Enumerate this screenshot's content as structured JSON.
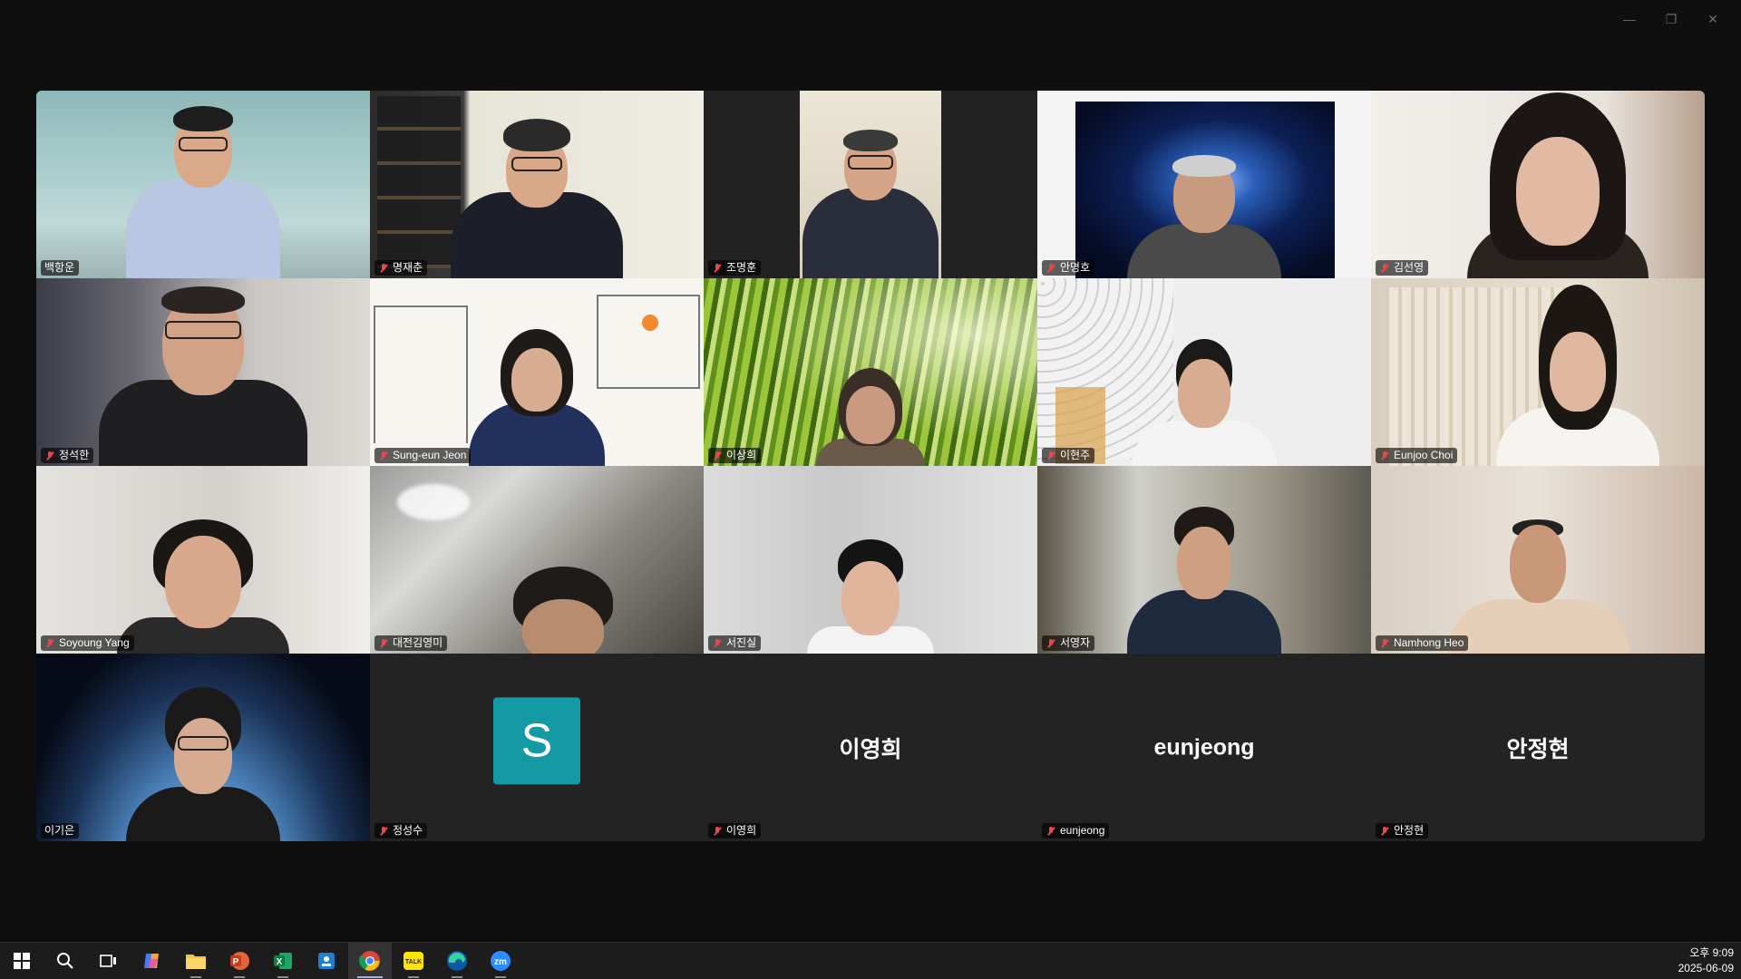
{
  "window": {
    "controls": [
      {
        "name": "minimize-button",
        "glyph": "—"
      },
      {
        "name": "restore-button",
        "glyph": "❐"
      },
      {
        "name": "close-button",
        "glyph": "✕"
      }
    ]
  },
  "participants": [
    {
      "name": "백항운",
      "muted": false,
      "video": true,
      "active_speaker": true
    },
    {
      "name": "명재춘",
      "muted": true,
      "video": true
    },
    {
      "name": "조명훈",
      "muted": true,
      "video": true
    },
    {
      "name": "안명호",
      "muted": true,
      "video": true
    },
    {
      "name": "김선영",
      "muted": true,
      "video": true
    },
    {
      "name": "정석한",
      "muted": true,
      "video": true
    },
    {
      "name": "Sung-eun Jeon",
      "muted": true,
      "video": true
    },
    {
      "name": "이상희",
      "muted": true,
      "video": true
    },
    {
      "name": "이현주",
      "muted": true,
      "video": true
    },
    {
      "name": "Eunjoo Choi",
      "muted": true,
      "video": true
    },
    {
      "name": "Soyoung Yang",
      "muted": true,
      "video": true
    },
    {
      "name": "대전김영미",
      "muted": true,
      "video": true
    },
    {
      "name": "서진실",
      "muted": true,
      "video": true
    },
    {
      "name": "서영자",
      "muted": true,
      "video": true
    },
    {
      "name": "Namhong Heo",
      "muted": true,
      "video": true
    },
    {
      "name": "이기은",
      "muted": false,
      "video": true
    },
    {
      "name": "정성수",
      "muted": true,
      "video": false,
      "avatar_letter": "S",
      "avatar_color": "#139aa4"
    },
    {
      "name": "이영희",
      "muted": true,
      "video": false,
      "display_name": "이영희"
    },
    {
      "name": "eunjeong",
      "muted": true,
      "video": false,
      "display_name": "eunjeong"
    },
    {
      "name": "안정현",
      "muted": true,
      "video": false,
      "display_name": "안정현"
    }
  ],
  "taskbar": {
    "icons": [
      {
        "name": "windows-start-icon"
      },
      {
        "name": "search-icon"
      },
      {
        "name": "task-view-icon"
      },
      {
        "name": "copilot-icon"
      },
      {
        "name": "file-explorer-icon",
        "state": "running"
      },
      {
        "name": "powerpoint-icon",
        "state": "running"
      },
      {
        "name": "excel-icon",
        "state": "running"
      },
      {
        "name": "app-icon"
      },
      {
        "name": "chrome-icon",
        "state": "active"
      },
      {
        "name": "kakaotalk-icon",
        "state": "running",
        "label": "TALK"
      },
      {
        "name": "edge-icon",
        "state": "running"
      },
      {
        "name": "zoom-icon",
        "state": "running",
        "label": "zm"
      }
    ],
    "clock": {
      "time": "오후 9:09",
      "date": "2025-06-09"
    }
  },
  "colors": {
    "active_speaker_border": "#31d07d",
    "muted_mic": "#e8484b",
    "background": "#0f0f0f",
    "tile_empty": "#232323"
  }
}
